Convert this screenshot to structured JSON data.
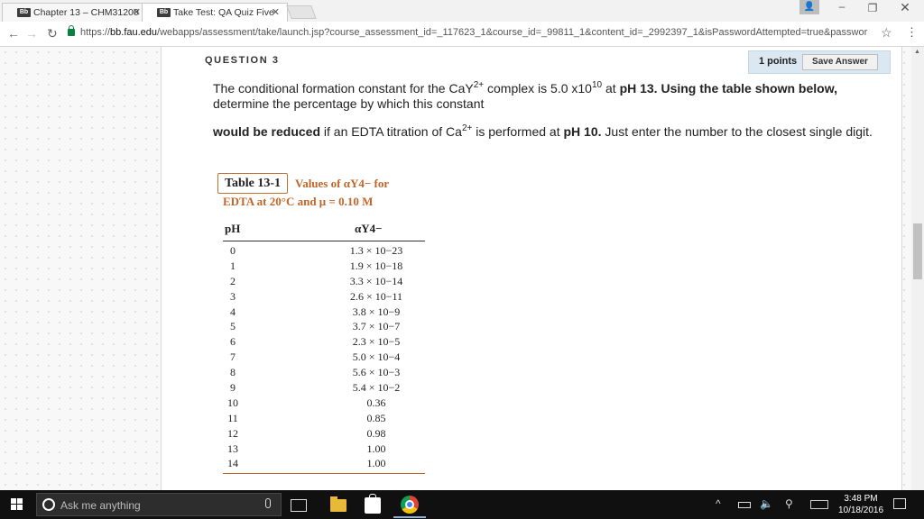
{
  "browser": {
    "tabs": [
      {
        "label": "Chapter 13 – CHM31200",
        "icon": "Bb",
        "active": false
      },
      {
        "label": "Take Test: QA Quiz Five",
        "icon": "Bb",
        "active": true
      }
    ],
    "url_scheme": "https://",
    "url_host": "bb.fau.edu",
    "url_path": "/webapps/assessment/take/launch.jsp?course_assessment_id=_117623_1&course_id=_99811_1&content_id=_2992397_1&isPasswordAttempted=true&passwor"
  },
  "question": {
    "title": "QUESTION 3",
    "points": "1 points",
    "save_label": "Save Answer",
    "p1_a": "The conditional  formation constant for the CaY",
    "p1_sup1": "2+",
    "p1_b": " complex is 5.0 x10",
    "p1_sup2": "10",
    "p1_c": " at ",
    "p1_bold": "pH 13. Using the table shown below,",
    "p1_d": "determine the percentage by which this constant",
    "p2_bold1": "would be reduced",
    "p2_a": " if an EDTA titration of Ca",
    "p2_sup": "2+",
    "p2_b": " is performed at ",
    "p2_bold2": "pH 10.",
    "p2_c": "  Just enter the number to the closest single digit."
  },
  "table": {
    "label": "Table 13-1",
    "title_line1": "Values of αY4− for",
    "title_line2": "EDTA at 20°C and μ = 0.10 M",
    "col_ph": "pH",
    "col_alpha": "αY4−",
    "rows": [
      {
        "ph": "0",
        "alpha": "1.3 × 10−23"
      },
      {
        "ph": "1",
        "alpha": "1.9 × 10−18"
      },
      {
        "ph": "2",
        "alpha": "3.3 × 10−14"
      },
      {
        "ph": "3",
        "alpha": "2.6 × 10−11"
      },
      {
        "ph": "4",
        "alpha": "3.8 × 10−9"
      },
      {
        "ph": "5",
        "alpha": "3.7 × 10−7"
      },
      {
        "ph": "6",
        "alpha": "2.3 × 10−5"
      },
      {
        "ph": "7",
        "alpha": "5.0 × 10−4"
      },
      {
        "ph": "8",
        "alpha": "5.6 × 10−3"
      },
      {
        "ph": "9",
        "alpha": "5.4 × 10−2"
      },
      {
        "ph": "10",
        "alpha": "0.36"
      },
      {
        "ph": "11",
        "alpha": "0.85"
      },
      {
        "ph": "12",
        "alpha": "0.98"
      },
      {
        "ph": "13",
        "alpha": "1.00"
      },
      {
        "ph": "14",
        "alpha": "1.00"
      }
    ]
  },
  "taskbar": {
    "search_placeholder": "Ask me anything",
    "time": "3:48 PM",
    "date": "10/18/2016"
  },
  "colors": {
    "accent_orange": "#c0662a",
    "points_bg": "#dbe8f2",
    "taskbar_bg": "#101010"
  }
}
